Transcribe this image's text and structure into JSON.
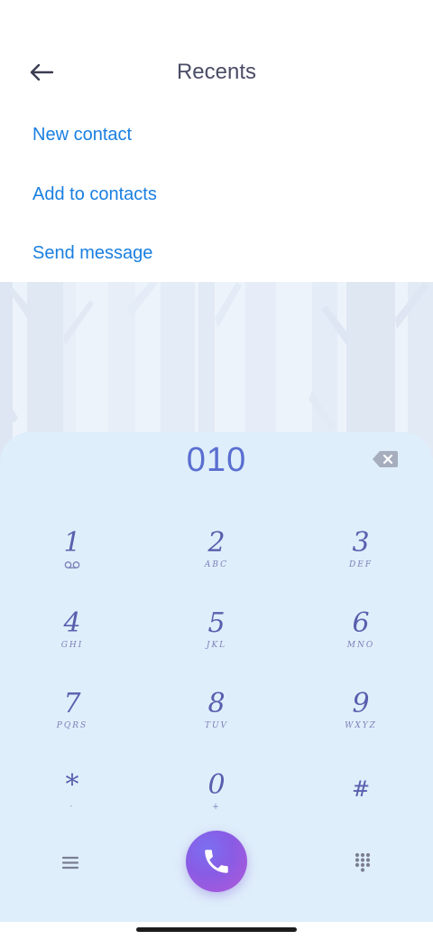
{
  "header": {
    "title": "Recents"
  },
  "actions": {
    "new_contact": "New contact",
    "add_to_contacts": "Add to contacts",
    "send_message": "Send message"
  },
  "dialer": {
    "number": "010",
    "keys": [
      {
        "digit": "1",
        "letters": ""
      },
      {
        "digit": "2",
        "letters": "ABC"
      },
      {
        "digit": "3",
        "letters": "DEF"
      },
      {
        "digit": "4",
        "letters": "GHI"
      },
      {
        "digit": "5",
        "letters": "JKL"
      },
      {
        "digit": "6",
        "letters": "MNO"
      },
      {
        "digit": "7",
        "letters": "PQRS"
      },
      {
        "digit": "8",
        "letters": "TUV"
      },
      {
        "digit": "9",
        "letters": "WXYZ"
      },
      {
        "digit": "*",
        "letters": "·"
      },
      {
        "digit": "0",
        "letters": "+"
      },
      {
        "digit": "#",
        "letters": ""
      }
    ]
  },
  "icons": {
    "back": "arrow-left-icon",
    "backspace": "backspace-icon",
    "voicemail": "voicemail-icon",
    "menu": "menu-icon",
    "call": "phone-icon",
    "dialpad": "dialpad-grid-icon"
  },
  "colors": {
    "accent_link": "#1a7fe0",
    "number_text": "#5a6fd0",
    "pad_background": "#dfeefb",
    "call_button": "#8a5be4"
  }
}
